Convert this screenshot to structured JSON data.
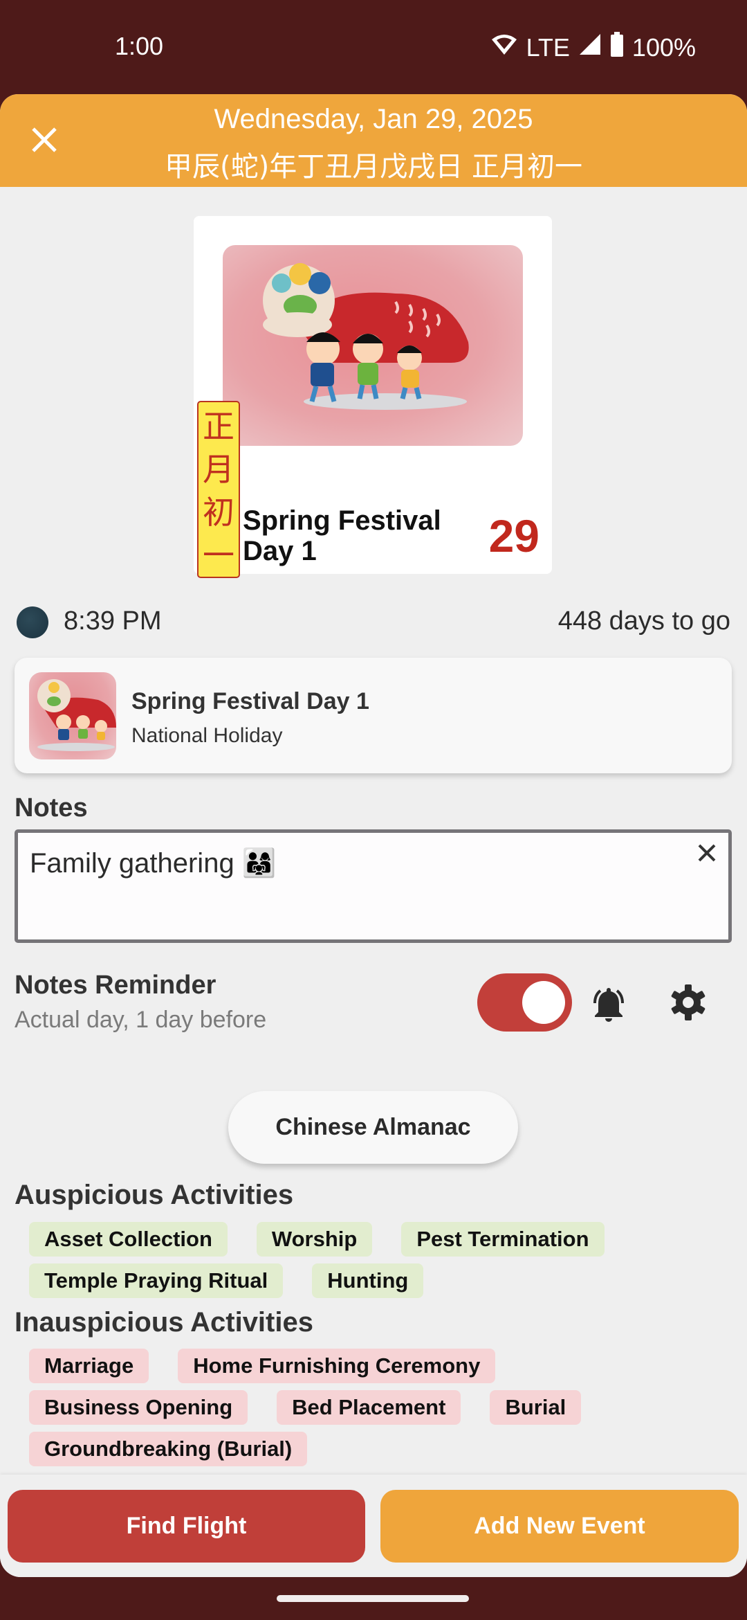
{
  "status_bar": {
    "time": "1:00",
    "network": "LTE",
    "battery": "100%",
    "icons": [
      "wifi-icon",
      "signal-icon",
      "battery-icon"
    ]
  },
  "header": {
    "date": "Wednesday, Jan 29, 2025",
    "lunar_date": "甲辰(蛇)年丁丑月戊戌日 正月初一",
    "close_icon": "close-icon",
    "color": "#efa63c"
  },
  "festival_card": {
    "vertical_label": [
      "正",
      "月",
      "初",
      "一"
    ],
    "title": "Spring Festival Day 1",
    "day": "29",
    "image": "lion-dance-illustration"
  },
  "info_row": {
    "moon_icon": "moon-phase-icon",
    "moonrise_time": "8:39 PM",
    "countdown": "448 days to go"
  },
  "event": {
    "title": "Spring Festival Day 1",
    "subtitle": "National Holiday",
    "thumbnail": "lion-dance-thumbnail"
  },
  "notes": {
    "label": "Notes",
    "value": "Family gathering 👨‍👩‍👧",
    "clear_icon": "close-icon"
  },
  "reminder": {
    "title": "Notes Reminder",
    "subtitle": "Actual day, 1 day before",
    "enabled": true,
    "toggle_color": "#c23f3a"
  },
  "almanac_button": "Chinese Almanac",
  "auspicious": {
    "title": "Auspicious Activities",
    "items": [
      "Asset Collection",
      "Worship",
      "Pest Termination",
      "Temple Praying Ritual",
      "Hunting"
    ]
  },
  "inauspicious": {
    "title": "Inauspicious Activities",
    "items": [
      "Marriage",
      "Home Furnishing Ceremony",
      "Business Opening",
      "Bed Placement",
      "Burial",
      "Groundbreaking (Burial)"
    ]
  },
  "actions": {
    "find_flight": "Find Flight",
    "add_event": "Add New Event",
    "find_flight_color": "#c03f39",
    "add_event_color": "#efa53b"
  }
}
